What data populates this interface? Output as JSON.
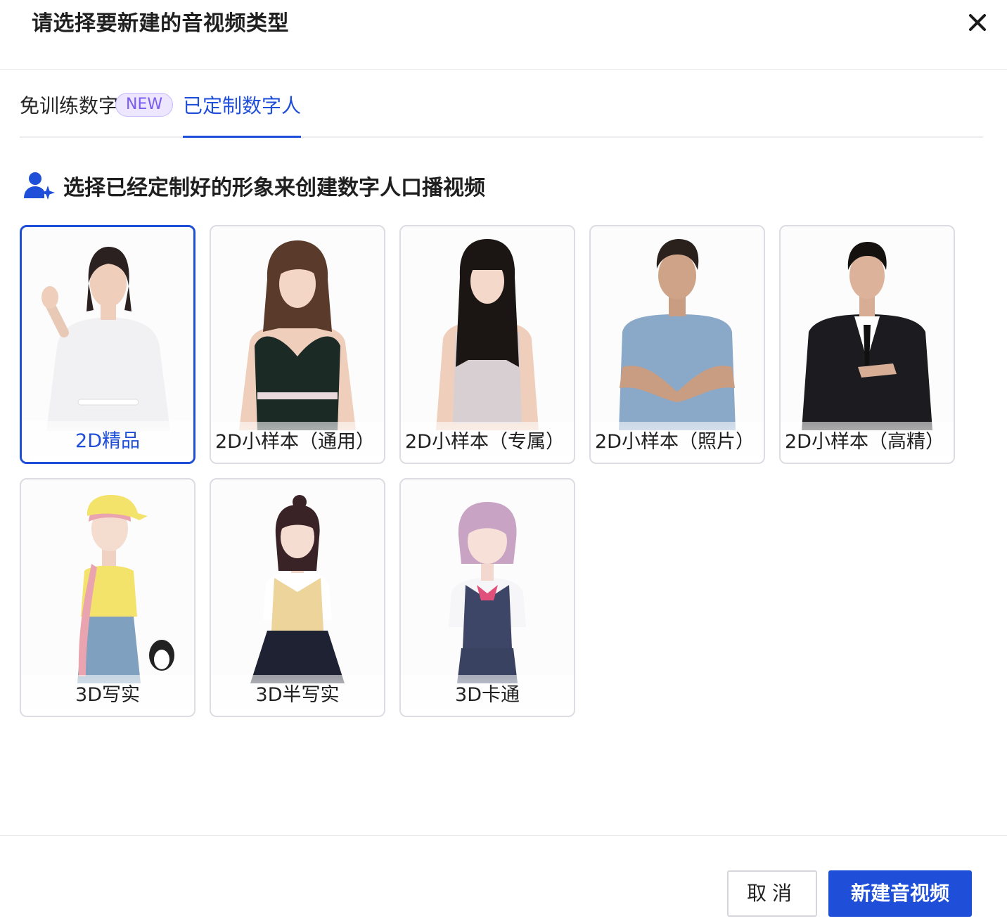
{
  "dialog": {
    "title": "请选择要新建的音视频类型",
    "close_icon": "close-icon"
  },
  "tabs": [
    {
      "label": "免训练数字人",
      "badge": "NEW",
      "active": false
    },
    {
      "label": "已定制数字人",
      "active": true
    }
  ],
  "section": {
    "icon": "user-sparkle-icon",
    "text": "选择已经定制好的形象来创建数字人口播视频"
  },
  "cards": [
    {
      "label": "2D精品",
      "selected": true
    },
    {
      "label": "2D小样本（通用）",
      "selected": false
    },
    {
      "label": "2D小样本（专属）",
      "selected": false
    },
    {
      "label": "2D小样本（照片）",
      "selected": false
    },
    {
      "label": "2D小样本（高精）",
      "selected": false
    },
    {
      "label": "3D写实",
      "selected": false
    },
    {
      "label": "3D半写实",
      "selected": false
    },
    {
      "label": "3D卡通",
      "selected": false
    }
  ],
  "footer": {
    "cancel_label": "取消",
    "create_label": "新建音视频"
  },
  "colors": {
    "primary": "#1f4fd8",
    "badge_bg": "#ece6ff",
    "badge_text": "#7b5cf0"
  }
}
